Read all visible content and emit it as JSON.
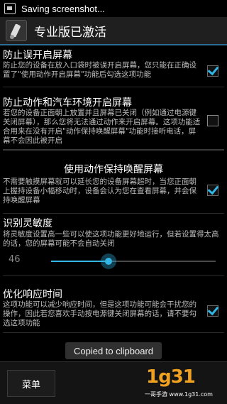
{
  "status_bar": {
    "text": "Saving screenshot..."
  },
  "action_bar": {
    "title": "专业版已激活"
  },
  "prefs": [
    {
      "title": "防止误开启屏幕",
      "summary": "防止您的设备在放入口袋时被误开启屏幕，您只能在正确设置了\"使用动作开启屏幕\"功能后勾选这项功能",
      "checked": true
    },
    {
      "title": "防止动作和汽车环境开启屏幕",
      "summary": "若您的设备正面朝上放置并且屏幕已关闭（例如通过电源键关闭屏幕），那么您将无法通过动作来开启屏幕。这项功能适合用来在没有开启\"动作保持唤醒屏幕\"功能时接听电话，屏幕不会因此被开启",
      "checked": false
    }
  ],
  "category": {
    "title": "使用动作保持唤醒屏幕"
  },
  "keep_awake": {
    "summary": "不需要触摸屏幕就可以延长您的设备屏幕超时，当您正面朝上握持设备小幅移动时，设备会认为您在查看屏幕，并会保持唤醒屏幕",
    "checked": true
  },
  "sensitivity": {
    "title": "识别灵敏度",
    "summary": "将灵敏度设置高一些可以使这项功能更好地运行，但若设置得太高的话，您的屏幕可能不会自动关闭",
    "value": "46",
    "fraction": 0.35
  },
  "response": {
    "title": "优化响应时间",
    "summary": "这项功能可以减少响应时间，但是这项功能可能会干扰您的操作，因此若您喜欢手动按电源键关闭屏幕的话，请不要勾选这项功能",
    "checked": true
  },
  "toast": {
    "text": "Copied to clipboard"
  },
  "bottom": {
    "menu_label": "菜单"
  },
  "watermark": {
    "number": "1g31",
    "text": "一哥手游 www.1g31.com"
  }
}
